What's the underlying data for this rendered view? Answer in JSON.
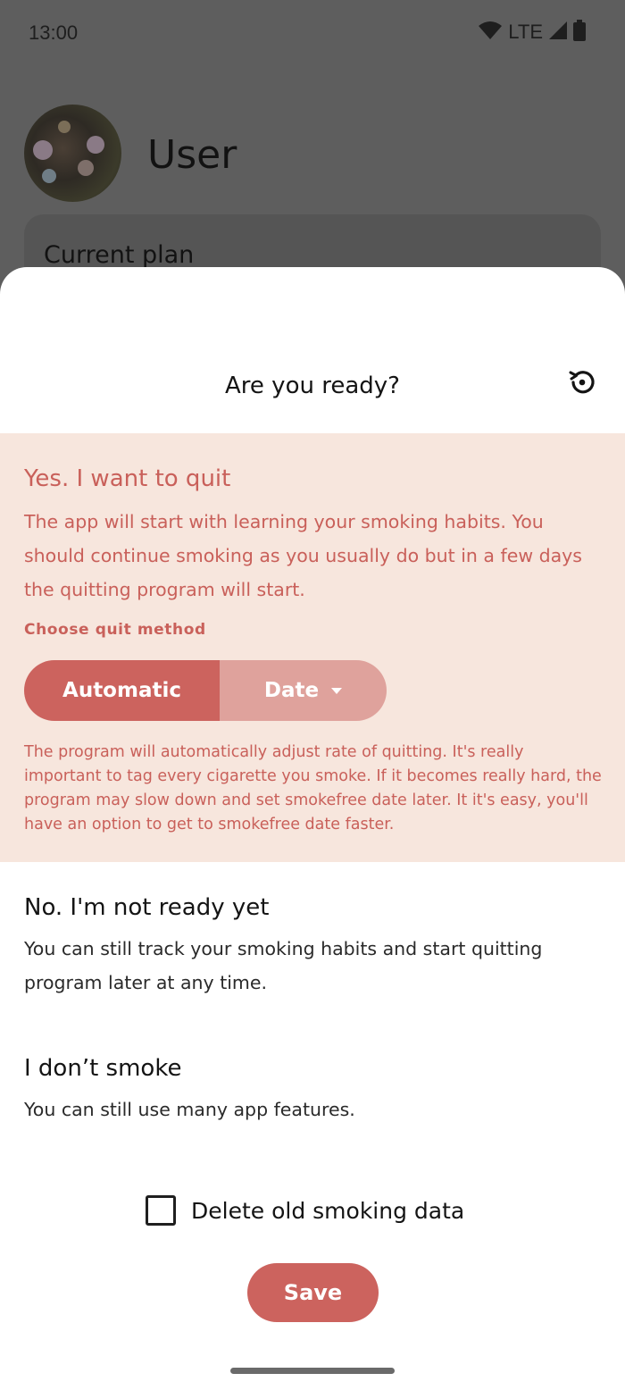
{
  "status_bar": {
    "time": "13:00",
    "network": "LTE",
    "icons": [
      "wifi-icon",
      "signal-icon",
      "battery-icon"
    ]
  },
  "background": {
    "user_name": "User",
    "plan_card_title": "Current plan"
  },
  "sheet": {
    "title": "Are you ready?",
    "reset_icon": "history-reset-icon",
    "options": {
      "yes": {
        "title": "Yes. I want to quit",
        "description": "The app will start with learning your smoking habits. You should continue smoking as you usually do but in a few days the quitting program will start.",
        "method_label": "Choose quit method",
        "methods": {
          "automatic": "Automatic",
          "date": "Date",
          "selected": "Automatic"
        },
        "method_description": "The program will automatically adjust rate of quitting. It's really important to tag every cigarette you smoke. If it becomes really hard, the program may slow down and set smokefree date later. It it's easy, you'll have an option to get to smokefree date faster."
      },
      "no": {
        "title": "No. I'm not ready yet",
        "description": "You can still track your smoking habits and start quitting program later at any time."
      },
      "dont_smoke": {
        "title": "I don’t smoke",
        "description": "You can still use many app features."
      }
    },
    "delete_checkbox": {
      "label": "Delete old smoking data",
      "checked": false
    },
    "save_label": "Save"
  },
  "colors": {
    "accent": "#cc635e",
    "accent_light": "#dfa29c",
    "selected_bg": "#f7e6dd",
    "scrim": "#5e5e5e"
  }
}
